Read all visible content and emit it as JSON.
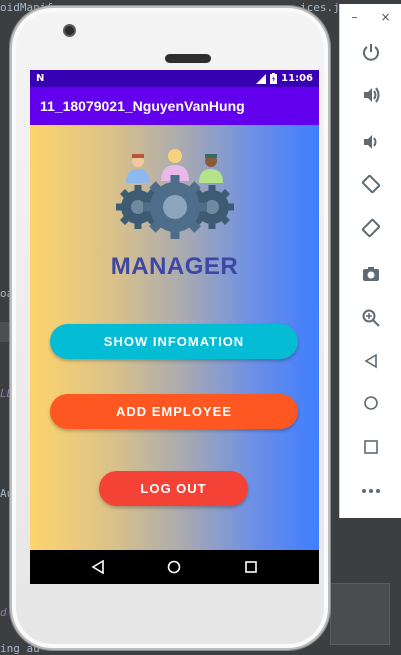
{
  "ide": {
    "tab_text_1": "oidManif",
    "tab_text_2": "ices.jsc",
    "side_text_1": "oa",
    "side_text_2": "LB",
    "side_text_3": "Au",
    "side_text_4": "d",
    "bottom_text": "ing au"
  },
  "emulator": {
    "minimize_label": "–",
    "close_label": "×",
    "tools": [
      "power-icon",
      "volume-up-icon",
      "volume-down-icon",
      "rotate-left-icon",
      "rotate-right-icon",
      "camera-icon",
      "zoom-icon",
      "back-icon",
      "home-icon",
      "overview-icon",
      "more-icon"
    ]
  },
  "statusbar": {
    "time": "11:06"
  },
  "appbar": {
    "title": "11_18079021_NguyenVanHung"
  },
  "main": {
    "heading": "MANAGER",
    "buttons": {
      "show": "SHOW INFOMATION",
      "add": "ADD EMPLOYEE",
      "logout": "LOG OUT"
    }
  },
  "colors": {
    "statusbar": "#3700b3",
    "appbar": "#6200ee",
    "heading": "#3d48a6",
    "show_button": "#04bcd4",
    "add_button": "#ff5722",
    "logout_button": "#f44336"
  }
}
